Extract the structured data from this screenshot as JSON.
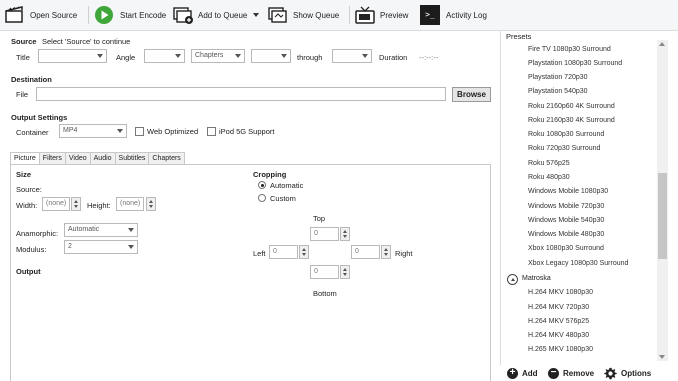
{
  "toolbar": {
    "open_source": "Open Source",
    "start_encode": "Start Encode",
    "add_to_queue": "Add to Queue",
    "show_queue": "Show Queue",
    "preview": "Preview",
    "activity_log": "Activity Log",
    "terminal_glyph": ">_"
  },
  "source": {
    "label": "Source",
    "hint": "Select 'Source' to continue",
    "title_label": "Title",
    "angle_label": "Angle",
    "range_mode": "Chapters",
    "through_label": "through",
    "duration_label": "Duration",
    "duration_value": "--:--:--"
  },
  "destination": {
    "label": "Destination",
    "file_label": "File",
    "file_value": "",
    "browse_label": "Browse"
  },
  "output_settings": {
    "label": "Output Settings",
    "container_label": "Container",
    "container_value": "MP4",
    "web_optimized": "Web Optimized",
    "ipod_support": "iPod 5G Support"
  },
  "tabs": [
    "Picture",
    "Filters",
    "Video",
    "Audio",
    "Subtitles",
    "Chapters"
  ],
  "picture": {
    "size_label": "Size",
    "source_label": "Source:",
    "width_label": "Width:",
    "width_value": "(none)",
    "height_label": "Height:",
    "height_value": "(none)",
    "anamorphic_label": "Anamorphic:",
    "anamorphic_value": "Automatic",
    "modulus_label": "Modulus:",
    "modulus_value": "2",
    "output_label": "Output",
    "cropping_label": "Cropping",
    "crop_automatic": "Automatic",
    "crop_custom": "Custom",
    "top_label": "Top",
    "left_label": "Left",
    "right_label": "Right",
    "bottom_label": "Bottom",
    "top_value": "0",
    "left_value": "0",
    "right_value": "0",
    "bottom_value": "0"
  },
  "presets": {
    "title": "Presets",
    "items": [
      "Fire TV 1080p30 Surround",
      "Playstation 1080p30 Surround",
      "Playstation 720p30",
      "Playstation 540p30",
      "Roku 2160p60 4K Surround",
      "Roku 2160p30 4K Surround",
      "Roku 1080p30 Surround",
      "Roku 720p30 Surround",
      "Roku 576p25",
      "Roku 480p30",
      "Windows Mobile 1080p30",
      "Windows Mobile 720p30",
      "Windows Mobile 540p30",
      "Windows Mobile 480p30",
      "Xbox 1080p30 Surround",
      "Xbox Legacy 1080p30 Surround"
    ],
    "group_label": "Matroska",
    "group_items": [
      "H.264 MKV 1080p30",
      "H.264 MKV 720p30",
      "H.264 MKV 576p25",
      "H.264 MKV 480p30",
      "H.265 MKV 1080p30"
    ],
    "add_label": "Add",
    "remove_label": "Remove",
    "options_label": "Options"
  }
}
